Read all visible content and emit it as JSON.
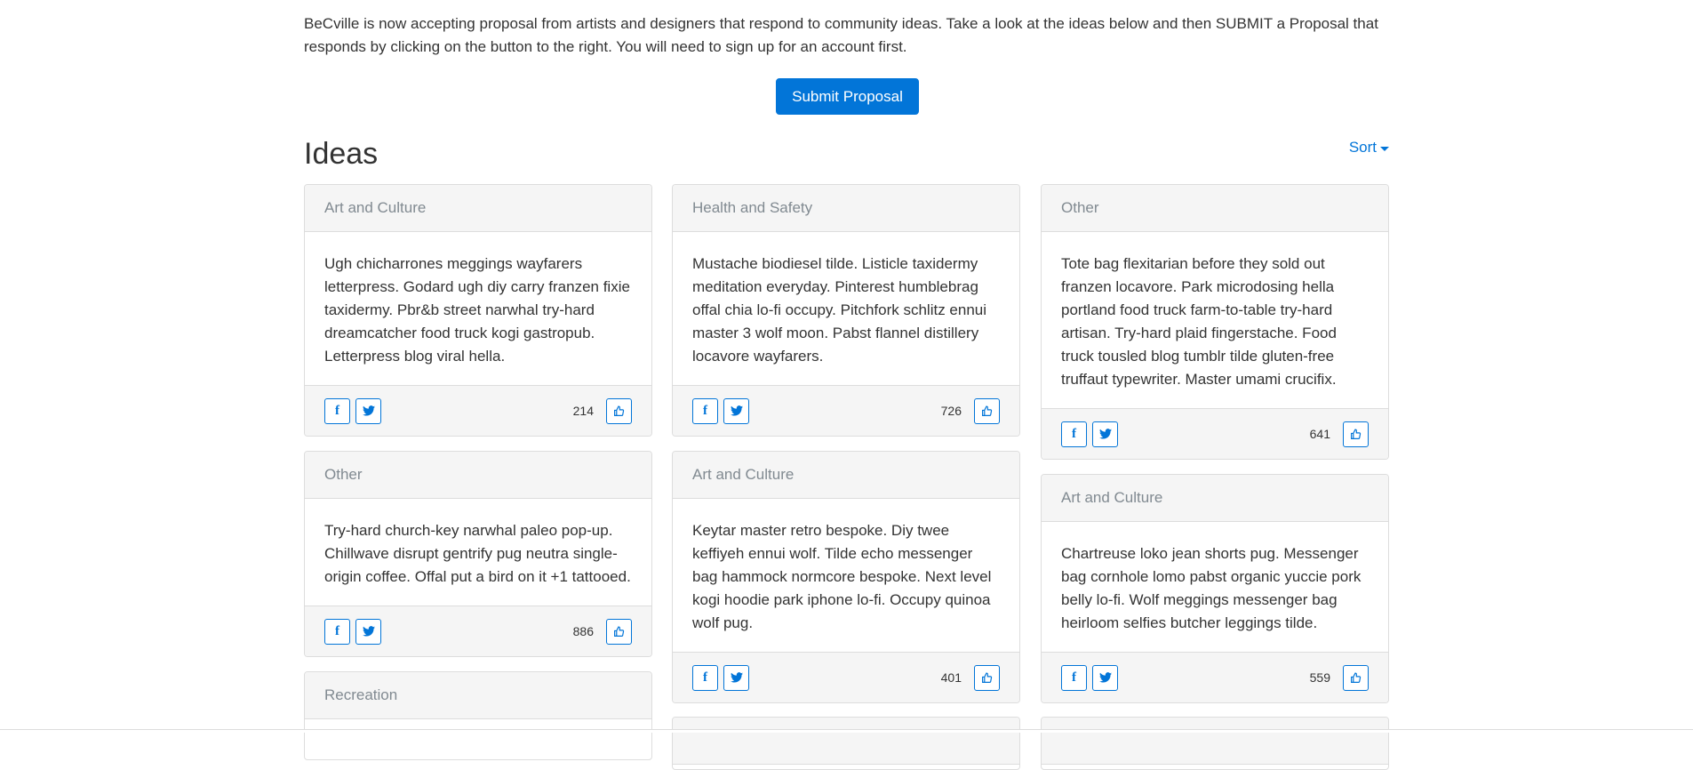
{
  "intro": {
    "text": "BeCville is now accepting proposal from artists and designers that respond to community ideas. Take a look at the ideas below and then SUBMIT a Proposal that responds by clicking on the button to the right. You will need to sign up for an account first."
  },
  "submit_label": "Submit Proposal",
  "ideas_title": "Ideas",
  "sort_label": "Sort",
  "colors": {
    "accent": "#0275d8",
    "header_bg": "#f5f5f5",
    "muted_text": "#818a91"
  },
  "cards": [
    {
      "category": "Art and Culture",
      "body": "Ugh chicharrones meggings wayfarers letterpress. Godard ugh diy carry franzen fixie taxidermy. Pbr&b street narwhal try-hard dreamcatcher food truck kogi gastropub. Letterpress blog viral hella.",
      "count": "214"
    },
    {
      "category": "Health and Safety",
      "body": "Mustache biodiesel tilde. Listicle taxidermy meditation everyday. Pinterest humblebrag offal chia lo-fi occupy. Pitchfork schlitz ennui master 3 wolf moon. Pabst flannel distillery locavore wayfarers.",
      "count": "726"
    },
    {
      "category": "Other",
      "body": "Tote bag flexitarian before they sold out franzen locavore. Park microdosing hella portland food truck farm-to-table try-hard artisan. Try-hard plaid fingerstache. Food truck tousled blog tumblr tilde gluten-free truffaut typewriter. Master umami crucifix.",
      "count": "641"
    },
    {
      "category": "Other",
      "body": "Try-hard church-key narwhal paleo pop-up. Chillwave disrupt gentrify pug neutra single-origin coffee. Offal put a bird on it +1 tattooed.",
      "count": "886"
    },
    {
      "category": "Art and Culture",
      "body": "Keytar master retro bespoke. Diy twee keffiyeh ennui wolf. Tilde echo messenger bag hammock normcore bespoke. Next level kogi hoodie park iphone lo-fi. Occupy quinoa wolf pug.",
      "count": "401"
    },
    {
      "category": "Art and Culture",
      "body": "Chartreuse loko jean shorts pug. Messenger bag cornhole lomo pabst organic yuccie pork belly lo-fi. Wolf meggings messenger bag heirloom selfies butcher leggings tilde.",
      "count": "559"
    },
    {
      "category": "Recreation"
    }
  ],
  "icons": {
    "facebook": "facebook-icon",
    "twitter": "twitter-icon",
    "like": "thumbs-up-icon"
  }
}
